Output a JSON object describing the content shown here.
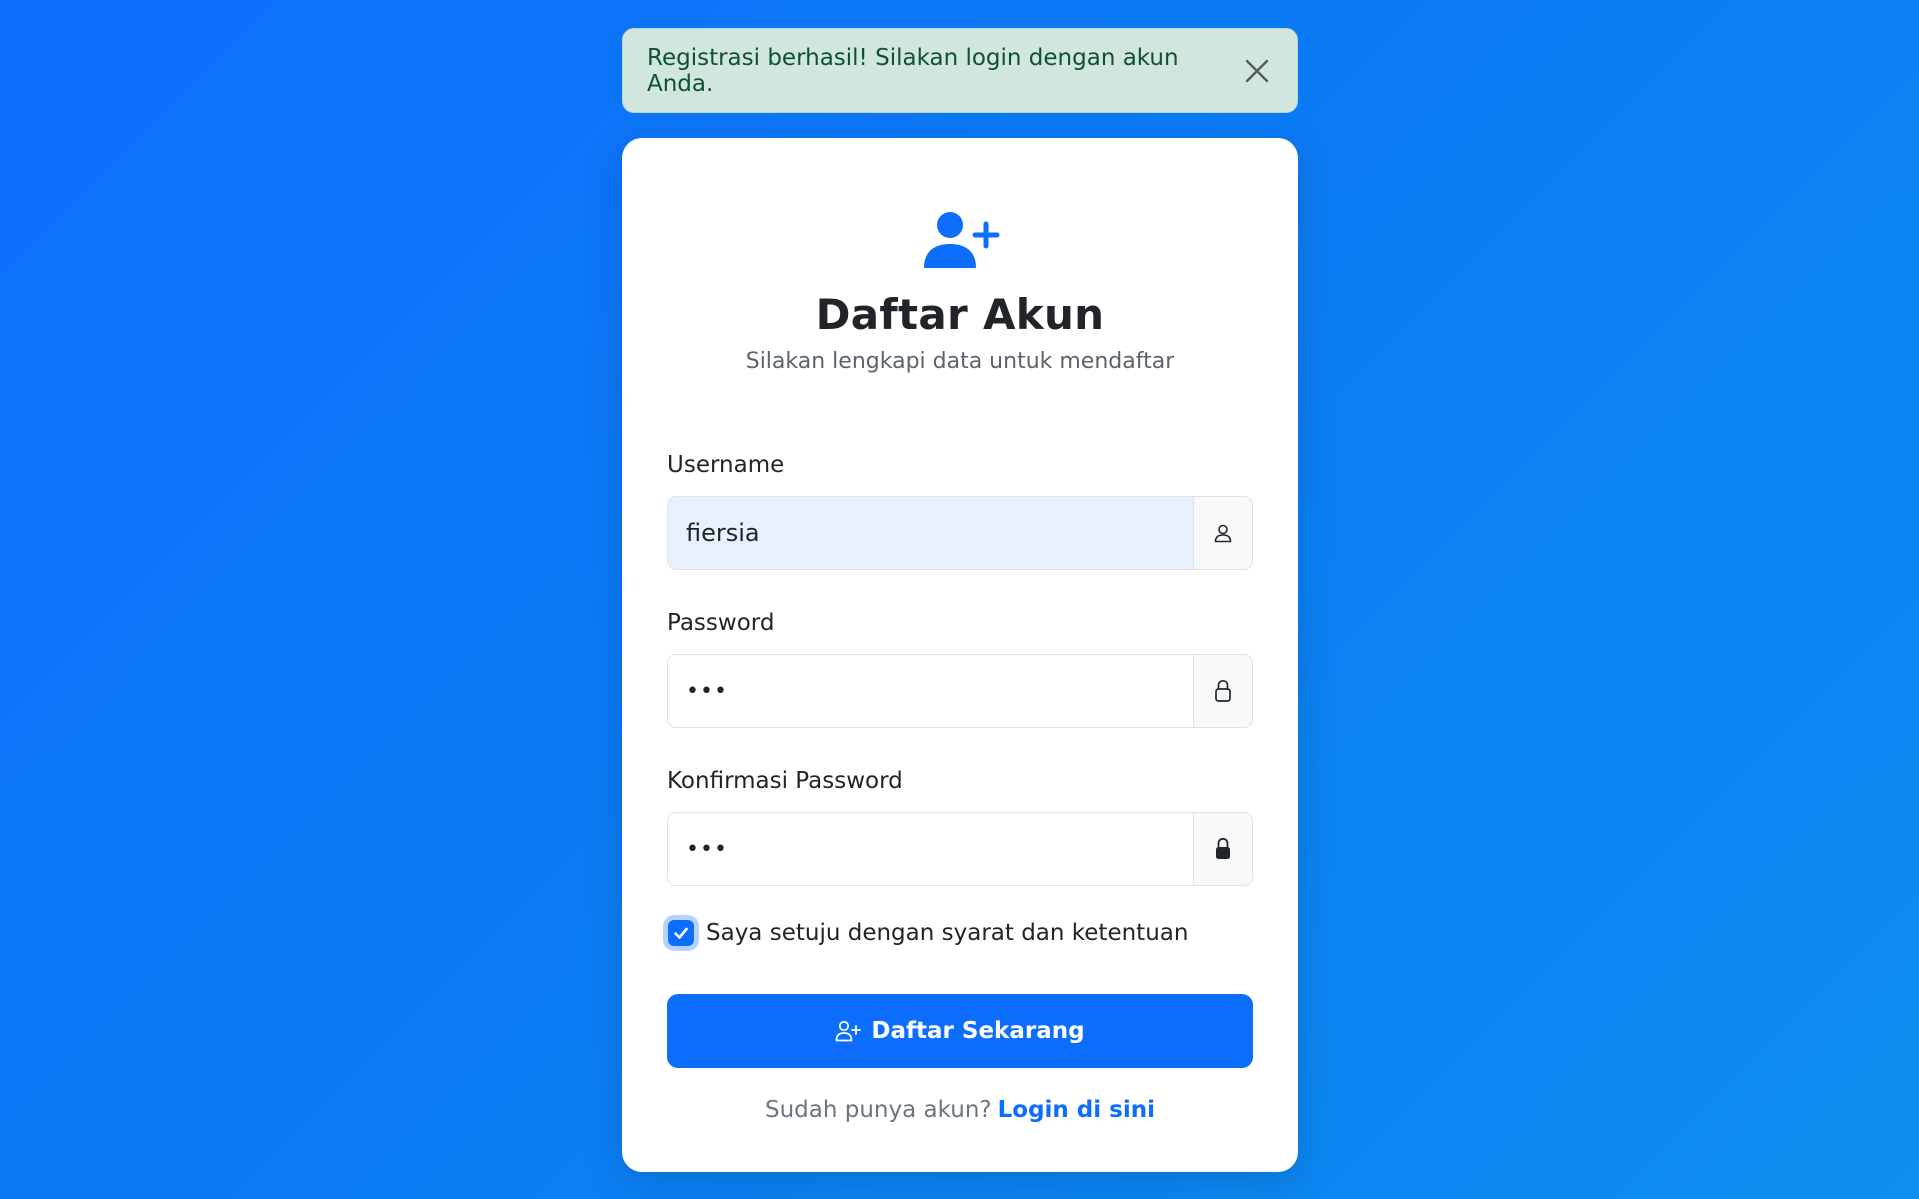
{
  "alert": {
    "message": "Registrasi berhasil! Silakan login dengan akun Anda.",
    "close_icon": "close-icon"
  },
  "header": {
    "icon": "person-plus-icon",
    "title": "Daftar Akun",
    "subtitle": "Silakan lengkapi data untuk mendaftar"
  },
  "form": {
    "username": {
      "label": "Username",
      "value": "fiersia",
      "icon": "person-icon"
    },
    "password": {
      "label": "Password",
      "value": "•••",
      "icon": "lock-outline-icon"
    },
    "confirm_password": {
      "label": "Konfirmasi Password",
      "value": "•••",
      "icon": "lock-fill-icon"
    },
    "terms": {
      "label": "Saya setuju dengan syarat dan ketentuan",
      "checked": true
    },
    "submit_label": "Daftar Sekarang"
  },
  "footer": {
    "prompt": "Sudah punya akun?",
    "link_label": "Login di sini"
  },
  "colors": {
    "primary": "#0d6efd",
    "alert_bg": "#d1e7dd",
    "alert_text": "#0f5132",
    "autofill_bg": "#e8f0fe"
  }
}
